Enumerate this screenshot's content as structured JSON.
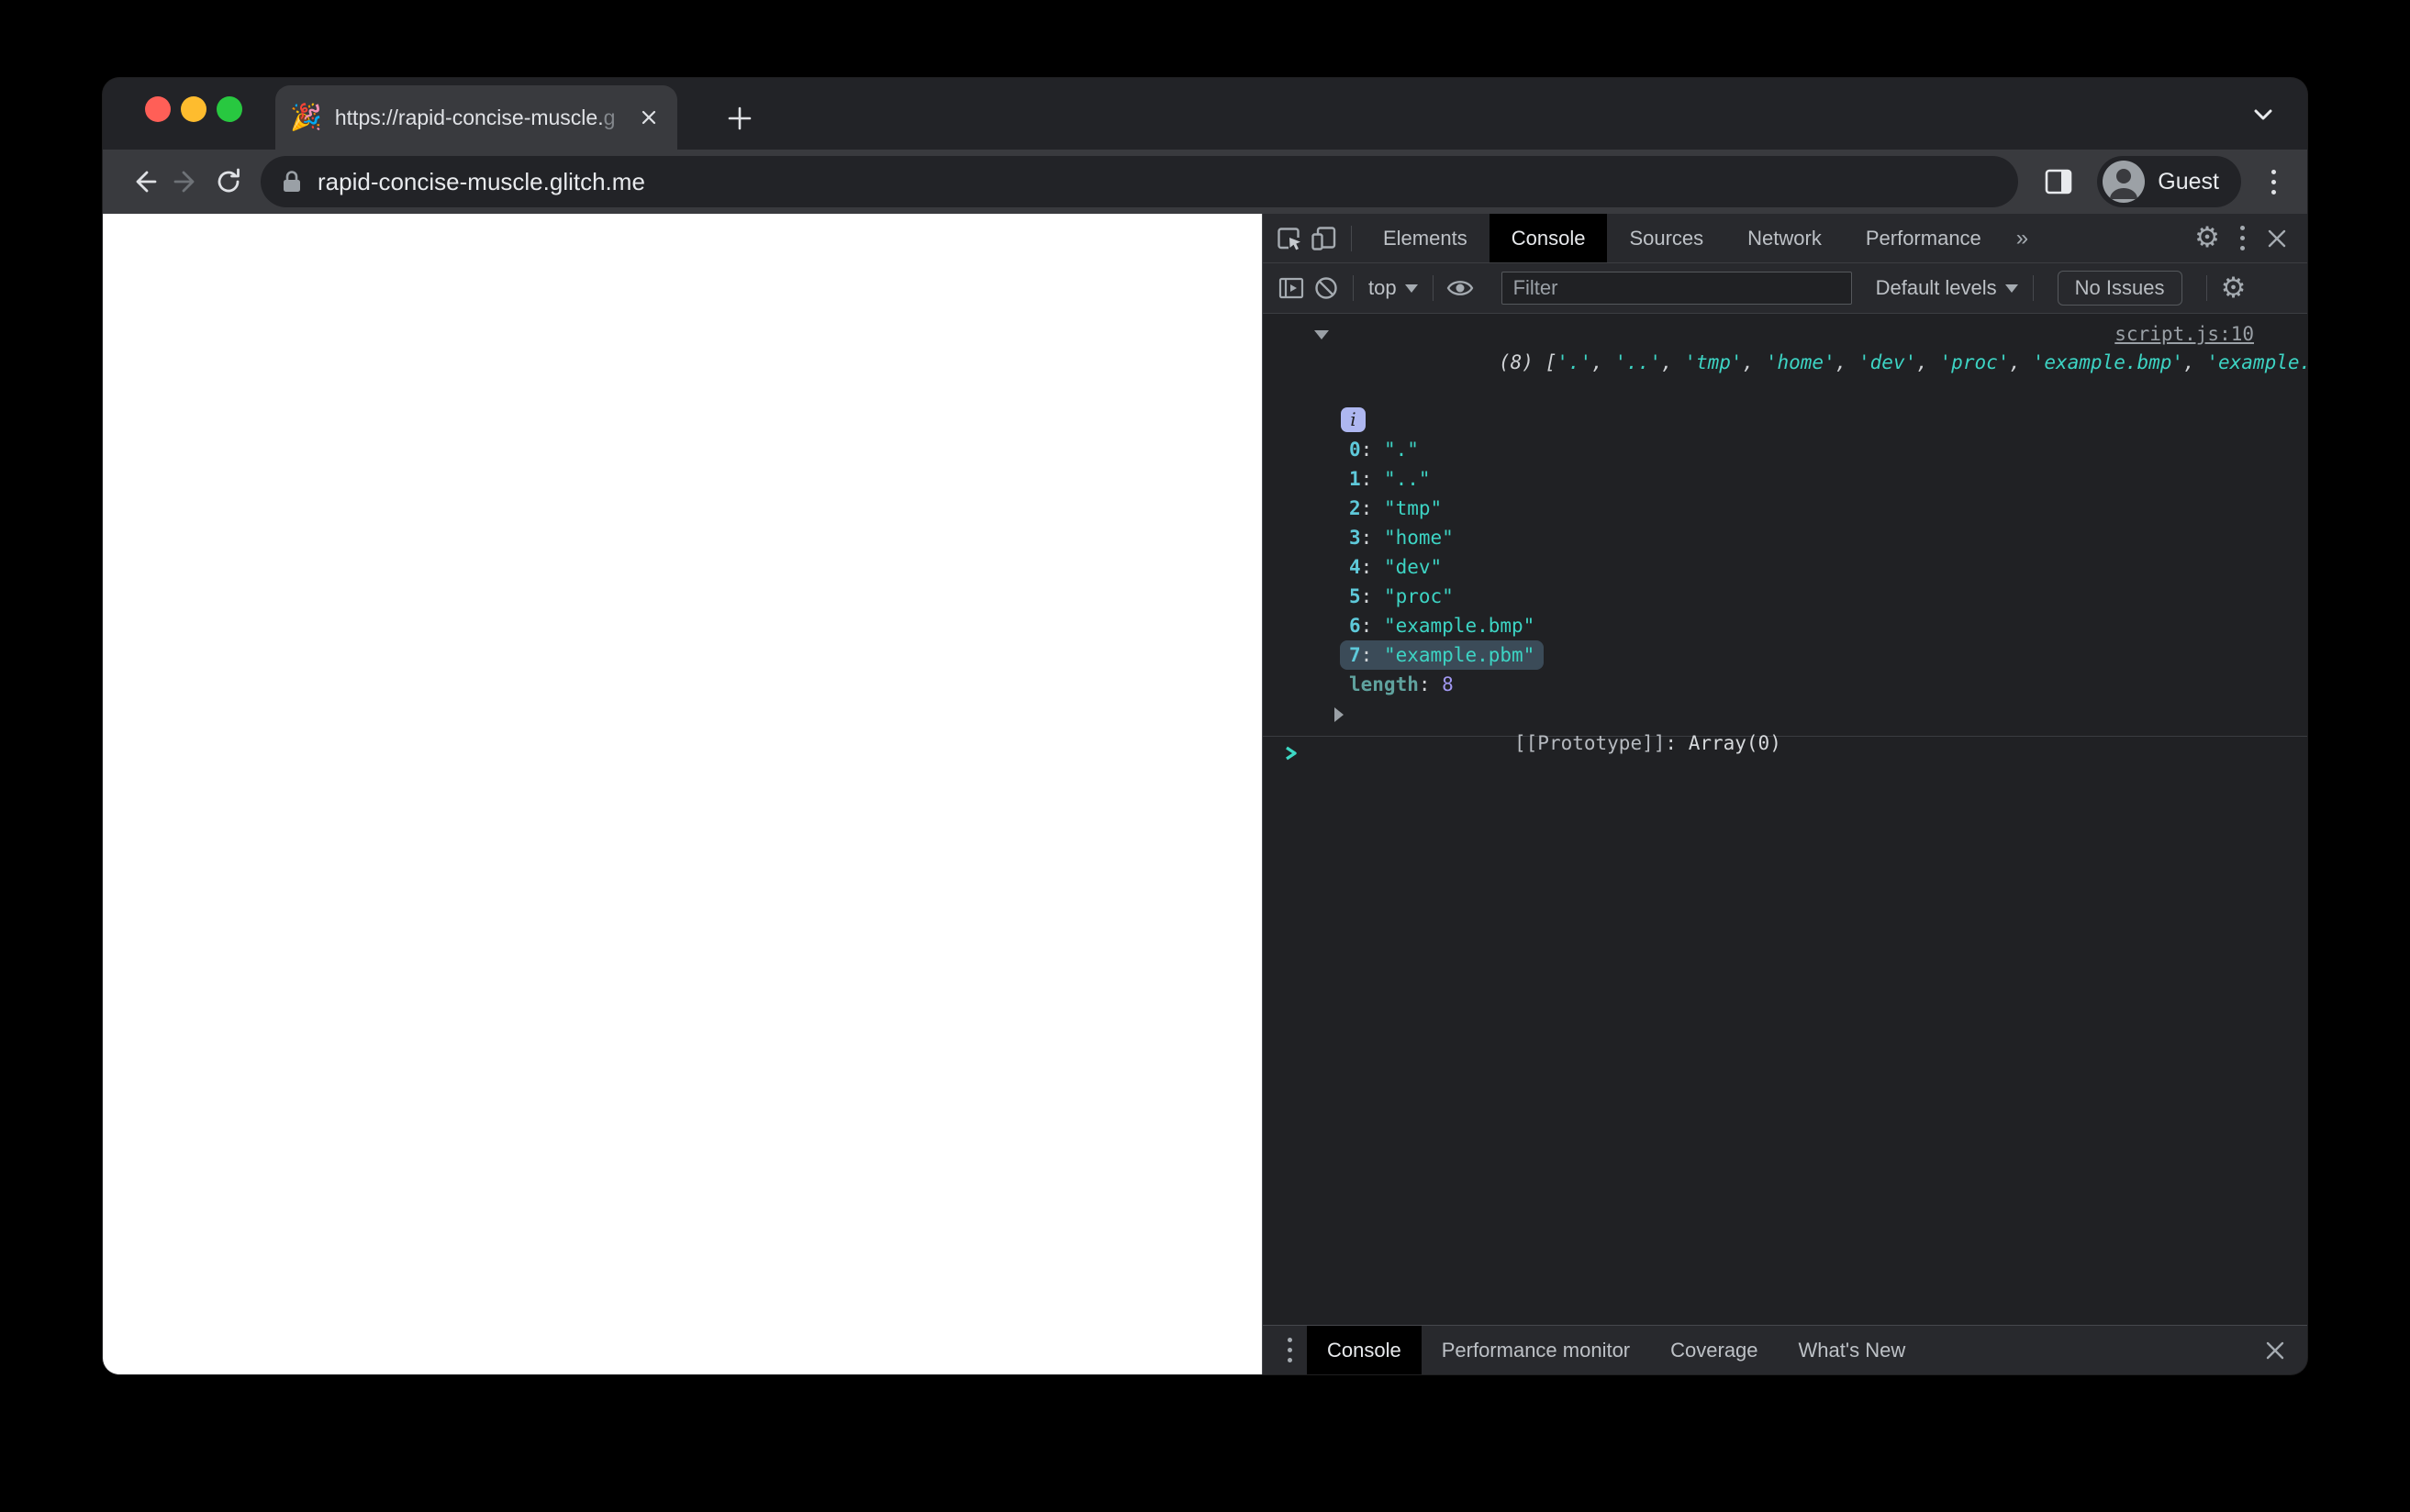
{
  "window": {
    "favicon": "🎉",
    "tab_title": "https://rapid-concise-muscle.",
    "tab_title_faded": "g",
    "url": "rapid-concise-muscle.glitch.me",
    "profile": "Guest"
  },
  "devtools": {
    "toolbar": {
      "tabs": [
        "Elements",
        "Console",
        "Sources",
        "Network",
        "Performance"
      ],
      "active_tab": "Console",
      "more_tabs": "»"
    },
    "filterbar": {
      "context": "top",
      "filter_placeholder": "Filter",
      "levels": "Default levels",
      "no_issues": "No Issues"
    },
    "console": {
      "source_link": "script.js:10",
      "preview": {
        "lead": "(8) [",
        "sep": ", ",
        "end": "]",
        "strings": [
          "'.'",
          "'..'",
          "'tmp'",
          "'home'",
          "'dev'",
          "'proc'",
          "'example.bmp'",
          "'example.pbm'"
        ]
      },
      "info_badge": "i",
      "colon": ": ",
      "items": [
        {
          "index": "0",
          "value": "\".\""
        },
        {
          "index": "1",
          "value": "\"..\""
        },
        {
          "index": "2",
          "value": "\"tmp\""
        },
        {
          "index": "3",
          "value": "\"home\""
        },
        {
          "index": "4",
          "value": "\"dev\""
        },
        {
          "index": "5",
          "value": "\"proc\""
        },
        {
          "index": "6",
          "value": "\"example.bmp\""
        },
        {
          "index": "7",
          "value": "\"example.pbm\""
        }
      ],
      "length_key": "length",
      "length_value": "8",
      "proto_key": "[[Prototype]]",
      "proto_value": "Array(0)"
    },
    "drawer": {
      "tabs": [
        "Console",
        "Performance monitor",
        "Coverage",
        "What's New"
      ],
      "active_tab": "Console"
    }
  },
  "colors": {
    "string_teal": "#3dd4c4",
    "index_cyan": "#5ec9da",
    "number_purple": "#a198f2",
    "highlight_bg": "#3b4b58",
    "badge_bg": "#aeb7f0",
    "devtools_bg": "#202124",
    "toolbar_bg": "#28292d",
    "chrome_toolbar_bg": "#393a3e"
  }
}
